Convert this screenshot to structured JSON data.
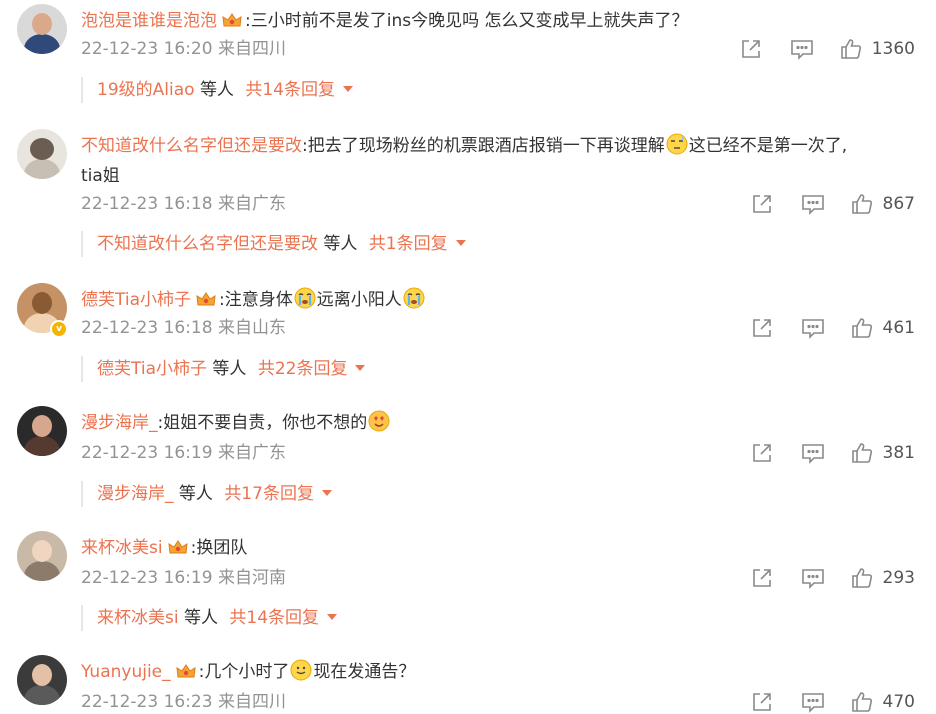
{
  "comments": [
    {
      "username": "泡泡是谁谁是泡泡",
      "text_parts": [
        ":三小时前不是发了ins今晚见吗 怎么又变成早上就失声了？"
      ],
      "timestamp": "22-12-23 16:20 来自四川",
      "likes": "1360",
      "reply_user": "19级的Aliao",
      "reply_mid": "等人",
      "reply_count": "共14条回复",
      "avatar_colors": [
        "#2f4a7a",
        "#d9a98a",
        "#8fa7c4"
      ],
      "has_crown": true,
      "verified": false
    },
    {
      "username": "不知道改什么名字但还是要改",
      "text_parts": [
        ":把去了现场粉丝的机票跟酒店报销一下再谈理解",
        "这已经不是第一次了,",
        "tia姐"
      ],
      "timestamp": "22-12-23 16:18 来自广东",
      "likes": "867",
      "reply_user": "不知道改什么名字但还是要改",
      "reply_mid": "等人",
      "reply_count": "共1条回复",
      "avatar_colors": [
        "#e8e4de",
        "#c8bfb4",
        "#6b5d52"
      ],
      "has_crown": false,
      "verified": false
    },
    {
      "username": "德芙Tia小柿子",
      "text_parts": [
        ":注意身体",
        "远离小阳人"
      ],
      "timestamp": "22-12-23 16:18 来自山东",
      "likes": "461",
      "reply_user": "德芙Tia小柿子",
      "reply_mid": "等人",
      "reply_count": "共22条回复",
      "avatar_colors": [
        "#c49265",
        "#f2d3b1",
        "#8a5a34"
      ],
      "has_crown": true,
      "verified": true
    },
    {
      "username": "漫步海岸_",
      "text_parts": [
        ":姐姐不要自责，你也不想的"
      ],
      "timestamp": "22-12-23 16:19 来自广东",
      "likes": "381",
      "reply_user": "漫步海岸_",
      "reply_mid": "等人",
      "reply_count": "共17条回复",
      "avatar_colors": [
        "#2a2a2a",
        "#d6a78e",
        "#553a30"
      ],
      "has_crown": false,
      "verified": false
    },
    {
      "username": "来杯冰美si",
      "text_parts": [
        ":换团队"
      ],
      "timestamp": "22-12-23 16:19 来自河南",
      "likes": "293",
      "reply_user": "来杯冰美si",
      "reply_mid": "等人",
      "reply_count": "共14条回复",
      "avatar_colors": [
        "#c9b9a7",
        "#f0d6c0",
        "#8c7a6a"
      ],
      "has_crown": true,
      "verified": false
    },
    {
      "username": "Yuanyujie_",
      "text_parts": [
        ":几个小时了",
        "现在发通告？"
      ],
      "timestamp": "22-12-23 16:23 来自四川",
      "likes": "470",
      "reply_user": "",
      "reply_mid": "",
      "reply_count": "",
      "avatar_colors": [
        "#3b3b3b",
        "#e3c0a6",
        "#5a5a5a"
      ],
      "has_crown": true,
      "verified": false
    }
  ],
  "icons": {
    "share": "share-icon",
    "comment": "comment-icon",
    "like": "thumbs-up-icon",
    "crown": "vip-crown-icon",
    "caret": "caret-down-icon"
  },
  "colors": {
    "username": "#eb7350",
    "meta": "#939393",
    "icon": "#8a8a8a"
  }
}
